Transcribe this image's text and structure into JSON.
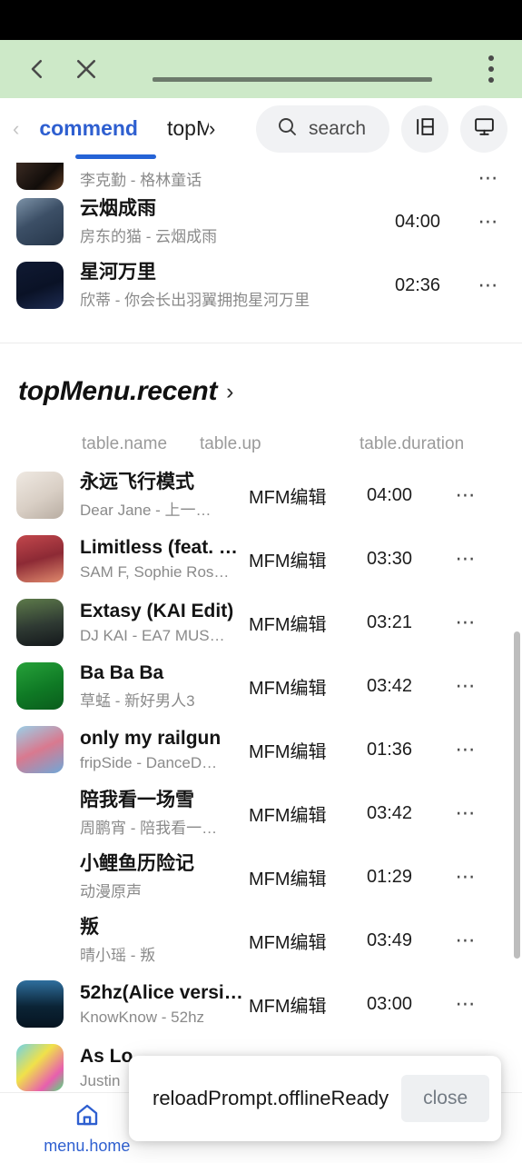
{
  "browser": {
    "back_icon": "chevron-left-icon",
    "close_icon": "close-icon",
    "url_value": "",
    "menu_icon": "more-vertical-icon",
    "chrome_color": "#cde9c8"
  },
  "header": {
    "prev_chevron": "‹",
    "next_chevron": "›",
    "tabs": [
      {
        "label": "commend",
        "active": true
      },
      {
        "label": "topM",
        "active": false
      }
    ],
    "accent": "#2e5fd0",
    "search": {
      "label": "search",
      "icon": "search-icon"
    },
    "layout_button": {
      "icon": "layout-sidebar-icon"
    },
    "display_button": {
      "icon": "monitor-icon"
    }
  },
  "top_list": [
    {
      "title": "",
      "artist": "李克勤 - 格林童话",
      "duration": "",
      "art": "linear-gradient(135deg,#3a2a22,#120d0a 60%,#5c3a22)"
    },
    {
      "title": "云烟成雨",
      "artist": "房东的猫 - 云烟成雨",
      "duration": "04:00",
      "art": "linear-gradient(150deg,#7d93a8,#3c4f66 45%,#26364a)"
    },
    {
      "title": "星河万里",
      "artist": "欣蒂 - 你会长出羽翼拥抱星河万里",
      "duration": "02:36",
      "art": "linear-gradient(160deg,#101a33,#0a1226 55%,#1d2b52)"
    }
  ],
  "section": {
    "title": "topMenu.recent",
    "chevron": "›"
  },
  "table": {
    "headers": {
      "name": "table.name",
      "up": "table.up",
      "duration": "table.duration"
    },
    "rows": [
      {
        "title": "永远飞行模式",
        "artist": "Dear Jane - 上一…",
        "up": "MFM编辑",
        "duration": "04:00",
        "art": "linear-gradient(150deg,#efe9e2,#d9cfc5 55%,#b8ada2)",
        "has_art": true
      },
      {
        "title": "Limitless (feat. …",
        "artist": "SAM F, Sophie Ros…",
        "up": "MFM编辑",
        "duration": "03:30",
        "art": "linear-gradient(165deg,#c2474c,#8d2a35 50%,#e08a6d)",
        "has_art": true
      },
      {
        "title": "Extasy (KAI Edit)",
        "artist": "DJ KAI - EA7 MUS…",
        "up": "MFM编辑",
        "duration": "03:21",
        "art": "linear-gradient(170deg,#5d7a4a,#2f3a33 55%,#14181b)",
        "has_art": true
      },
      {
        "title": "Ba Ba Ba",
        "artist": "草蜢 - 新好男人3",
        "up": "MFM编辑",
        "duration": "03:42",
        "art": "linear-gradient(160deg,#27a13a,#0f7a25 55%,#0a5c1c)",
        "has_art": true
      },
      {
        "title": "only my railgun",
        "artist": "fripSide - DanceD…",
        "up": "MFM编辑",
        "duration": "01:36",
        "art": "linear-gradient(155deg,#9ad0e8,#d9798f 50%,#6fa8d8)",
        "has_art": true
      },
      {
        "title": "陪我看一场雪",
        "artist": "周鹏宵 - 陪我看一…",
        "up": "MFM编辑",
        "duration": "03:42",
        "art": "",
        "has_art": false
      },
      {
        "title": "小鲤鱼历险记",
        "artist": "动漫原声",
        "up": "MFM编辑",
        "duration": "01:29",
        "art": "",
        "has_art": false
      },
      {
        "title": "叛",
        "artist": "晴小瑶 - 叛",
        "up": "MFM编辑",
        "duration": "03:49",
        "art": "",
        "has_art": false
      },
      {
        "title": "52hz(Alice versi…",
        "artist": "KnowKnow - 52hz",
        "up": "MFM编辑",
        "duration": "03:00",
        "art": "linear-gradient(180deg,#2f6f9e,#0b2436 55%,#061420)",
        "has_art": true
      },
      {
        "title": "As Lo",
        "artist": "Justin",
        "up": "",
        "duration": "",
        "art": "linear-gradient(135deg,#6fd2e8,#f0e14a 40%,#e85fae 75%,#4de07a)",
        "has_art": true
      }
    ]
  },
  "bottom_nav": [
    {
      "label": "menu.home",
      "icon": "home-icon",
      "active": true
    },
    {
      "label": "",
      "icon": "compass-icon",
      "active": false
    },
    {
      "label": "",
      "icon": "library-icon",
      "active": false
    }
  ],
  "toast": {
    "message": "reloadPrompt.offlineReady",
    "close_label": "close"
  }
}
